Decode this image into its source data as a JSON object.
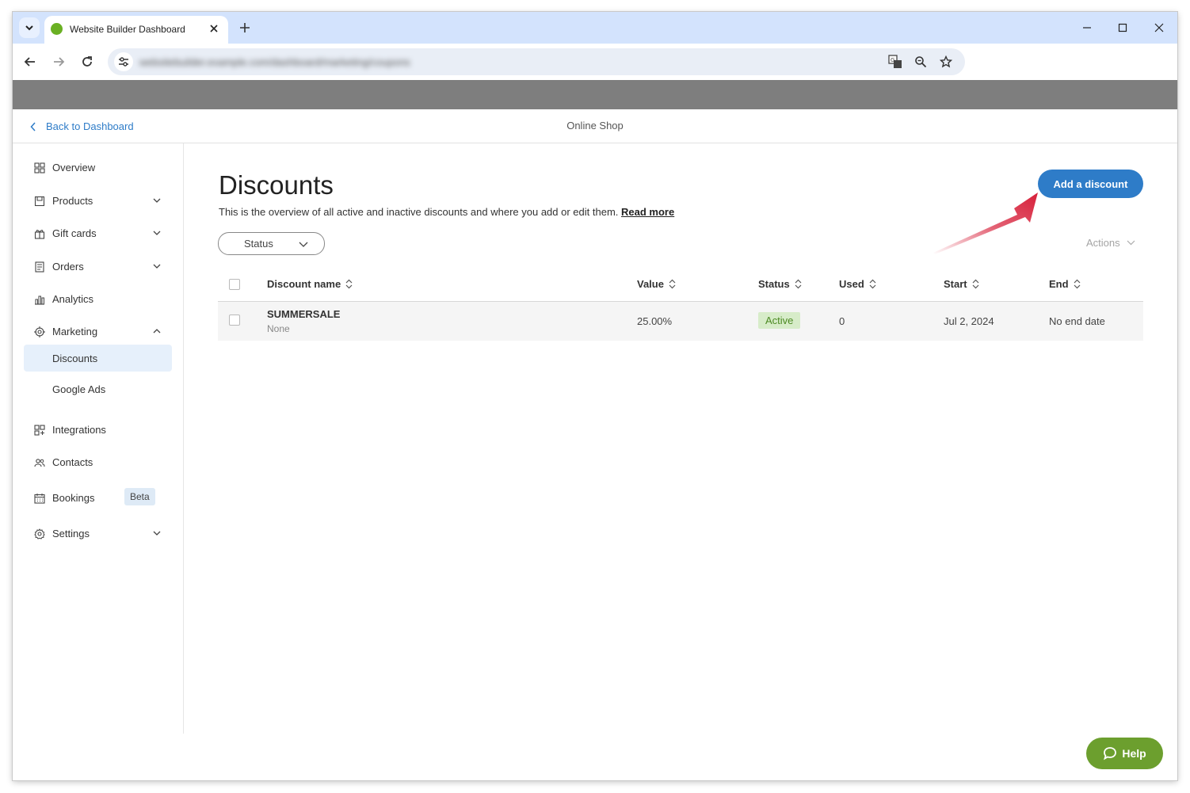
{
  "browser": {
    "tab_title": "Website Builder Dashboard",
    "url": "websitebuilder.example.com/dashboard/marketing/coupons"
  },
  "header": {
    "back_label": "Back to Dashboard",
    "shop_name": "Online Shop"
  },
  "sidebar": {
    "items": [
      {
        "label": "Overview",
        "icon": "grid-icon"
      },
      {
        "label": "Products",
        "icon": "box-icon"
      },
      {
        "label": "Gift cards",
        "icon": "gift-icon"
      },
      {
        "label": "Orders",
        "icon": "receipt-icon"
      },
      {
        "label": "Analytics",
        "icon": "bar-chart-icon"
      },
      {
        "label": "Marketing",
        "icon": "target-icon"
      },
      {
        "label": "Discounts"
      },
      {
        "label": "Google Ads"
      },
      {
        "label": "Integrations",
        "icon": "puzzle-grid-icon"
      },
      {
        "label": "Contacts",
        "icon": "people-icon"
      },
      {
        "label": "Bookings",
        "icon": "calendar-icon",
        "badge": "Beta"
      },
      {
        "label": "Settings",
        "icon": "gear-icon"
      }
    ]
  },
  "main": {
    "title": "Discounts",
    "description": "This is the overview of all active and inactive discounts and where you add or edit them.",
    "read_more": "Read more",
    "add_button": "Add a discount",
    "status_filter": "Status",
    "actions_label": "Actions",
    "columns": [
      "Discount name",
      "Value",
      "Status",
      "Used",
      "Start",
      "End"
    ],
    "rows": [
      {
        "name": "SUMMERSALE",
        "subtitle": "None",
        "value": "25.00%",
        "status": "Active",
        "used": "0",
        "start": "Jul 2, 2024",
        "end": "No end date"
      }
    ]
  },
  "help_label": "Help",
  "colors": {
    "accent": "#2e7cc8",
    "active_badge": "#d7ecc9",
    "help": "#6c9f2e",
    "arrow": "#d7203a"
  }
}
